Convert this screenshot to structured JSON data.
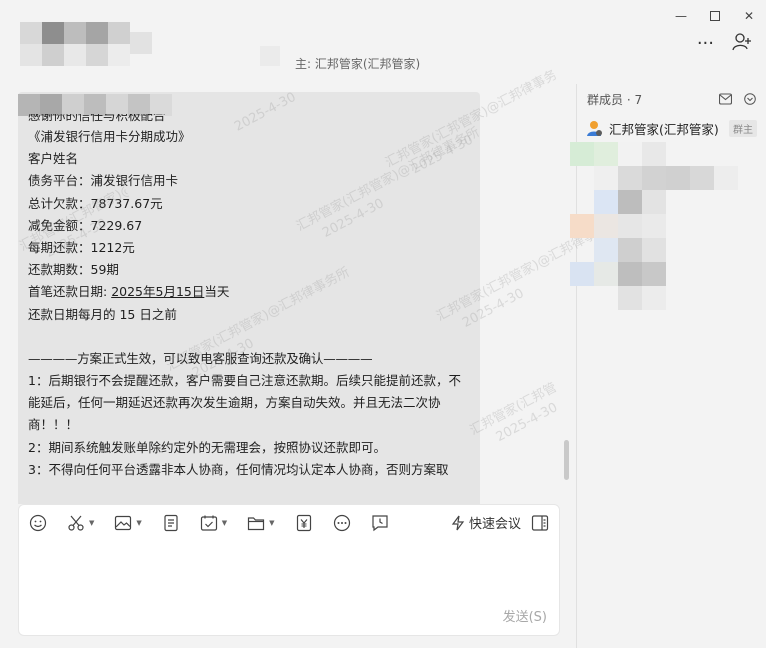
{
  "window": {
    "minimize_glyph": "—",
    "maximize_glyph": "☐",
    "close_glyph": "✕"
  },
  "header": {
    "subtitle": "主: 汇邦管家(汇邦管家)",
    "more_glyph": "···",
    "add_member_glyph": "+"
  },
  "message": {
    "lines": [
      "感谢你的信任与积极配合",
      "《浦发银行信用卡分期成功》",
      "客户姓名",
      "债务平台：浦发银行信用卡",
      "总计欠款：78737.67元",
      "减免金额：7229.67",
      "每期还款：1212元",
      "还款期数：59期"
    ],
    "first_payment_label": "首笔还款日期: ",
    "first_payment_date": "2025年5月15日",
    "first_payment_suffix": "当天",
    "monthly_due": "还款日期每月的 15 日之前",
    "notice_header": "————方案正式生效，可以致电客服查询还款及确认————",
    "rules": [
      "1：后期银行不会提醒还款，客户需要自己注意还款期。后续只能提前还款，不能延后，任何一期延迟还款再次发生逾期，方案自动失效。并且无法二次协商！！！",
      "2：期间系统触发账单除约定外的无需理会，按照协议还款即可。",
      "3：不得向任何平台透露非本人协商，任何情况均认定本人协商，否则方案取"
    ]
  },
  "watermarks": [
    "汇邦管家(汇邦管家)@汇邦律事务所",
    "2025-4-30"
  ],
  "compose": {
    "quick_meeting_label": "快速会议",
    "send_label": "发送(S)",
    "toolbar_icons": [
      "emoji-icon",
      "scissors-icon",
      "image-icon",
      "document-icon",
      "task-icon",
      "folder-icon",
      "red-packet-icon",
      "more-icon",
      "clock-icon"
    ]
  },
  "sidebar": {
    "header": "群成员 · 7",
    "member": {
      "name": "汇邦管家(汇邦管家)",
      "badge": "群主"
    }
  },
  "colors": {
    "bubble": "#e5e5e5",
    "background": "#f3f3f3",
    "owner_badge": "#e6e6e6"
  }
}
